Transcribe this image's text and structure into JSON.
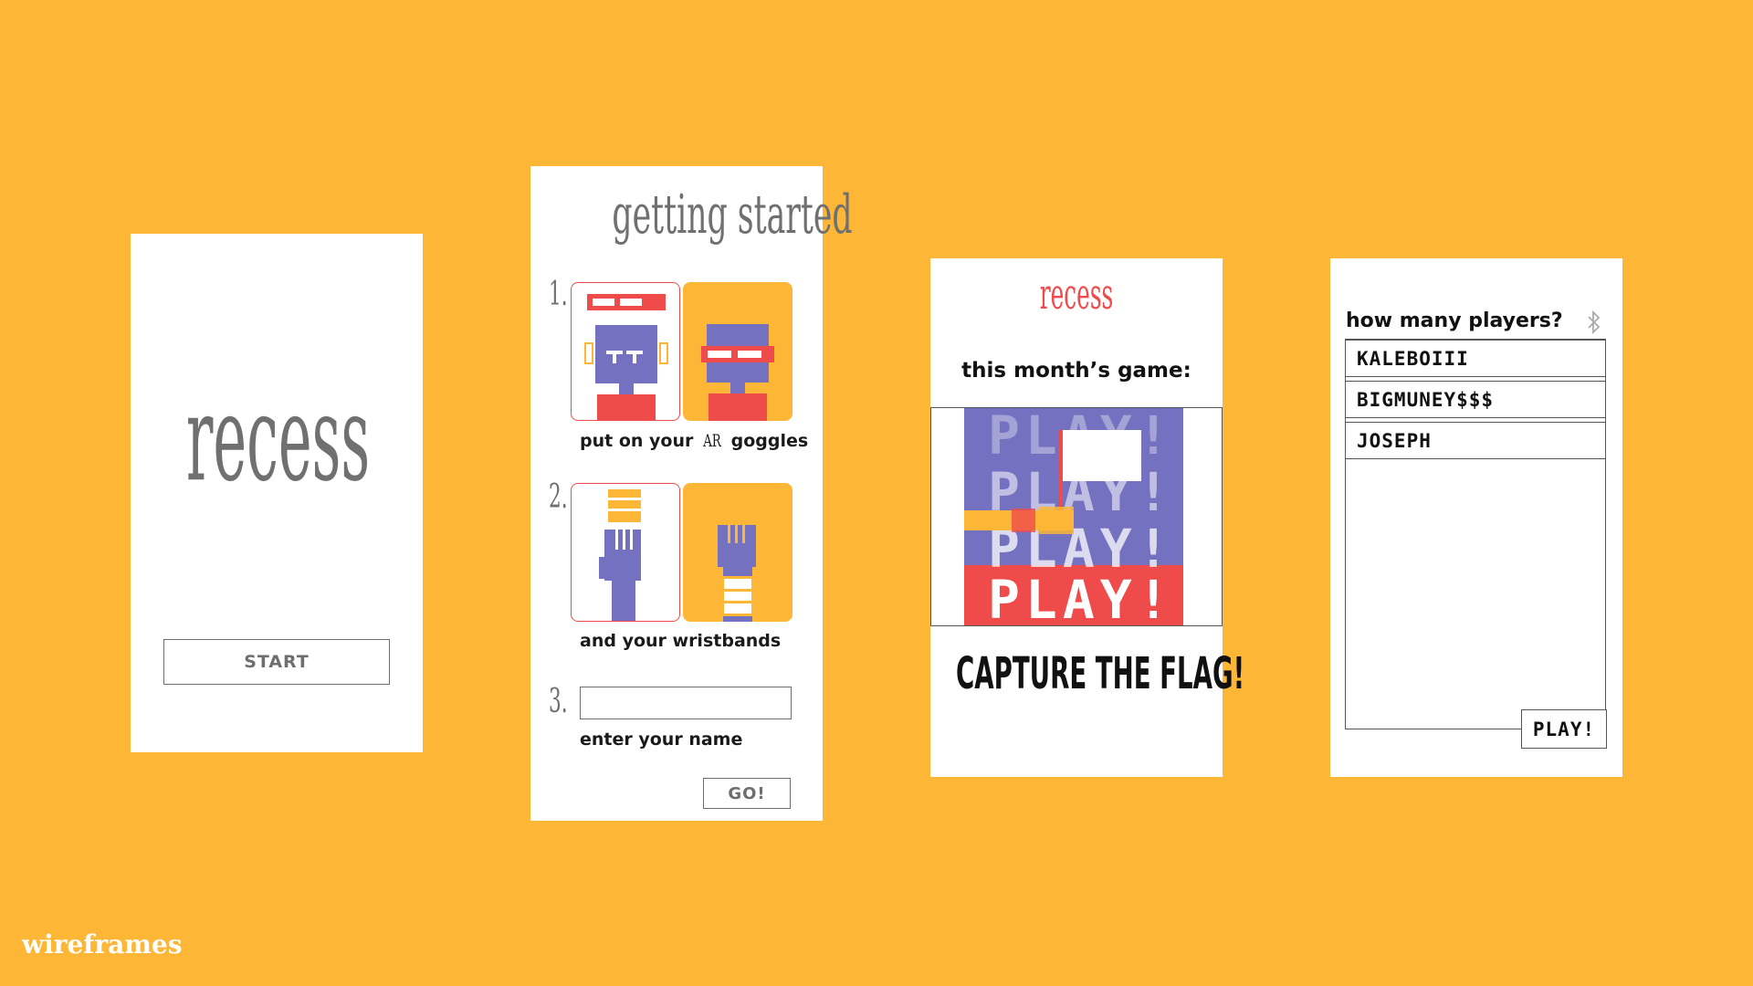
{
  "screen1": {
    "title": "recess",
    "start_label": "START"
  },
  "screen2": {
    "title": "getting started",
    "steps": [
      {
        "num": "1.",
        "caption_before": "put on your ",
        "caption_ar": "AR",
        "caption_after": " goggles"
      },
      {
        "num": "2.",
        "caption": "and your wristbands"
      },
      {
        "num": "3.",
        "caption": "enter your name",
        "name_value": ""
      }
    ],
    "go_label": "GO!"
  },
  "screen3": {
    "brand": "recess",
    "subtitle": "this month’s game:",
    "play_lines": [
      "PLAY!",
      "PLAY!",
      "PLAY!",
      "PLAY!"
    ],
    "game_title": "CAPTURE THE FLAG!"
  },
  "screen4": {
    "heading": "how many players?",
    "players": [
      "KALEBOIII",
      "BIGMUNEY$$$",
      "JOSEPH"
    ],
    "play_label": "PLAY!"
  },
  "footer": {
    "label": "wireframes"
  },
  "colors": {
    "background": "#FDB636",
    "accent_red": "#EF4B4B",
    "purple": "#7472C0",
    "gray": "#707070"
  }
}
